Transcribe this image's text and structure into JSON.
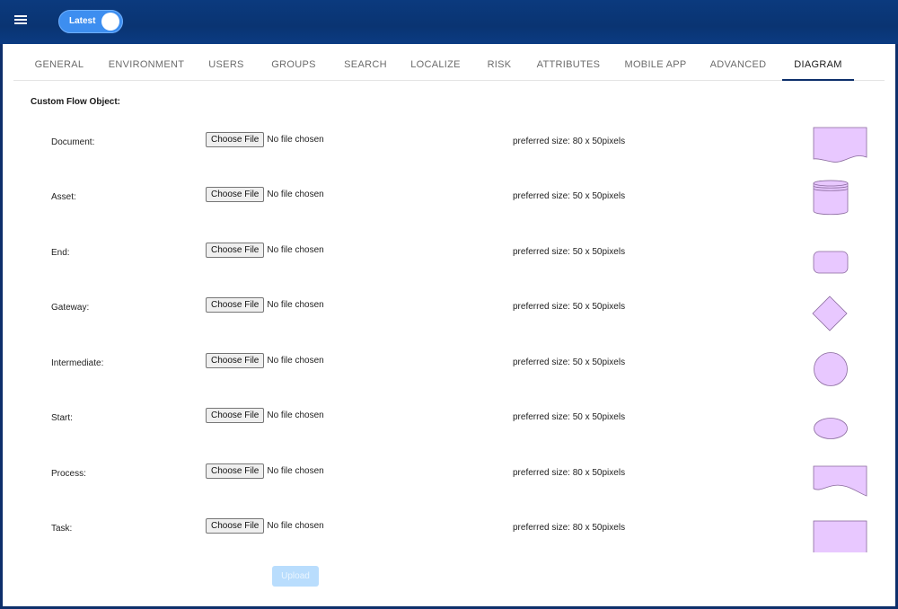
{
  "header": {
    "menu_icon": "hamburger-icon",
    "version_toggle_label": "Latest"
  },
  "tabs": [
    {
      "label": "GENERAL"
    },
    {
      "label": "ENVIRONMENT"
    },
    {
      "label": "USERS"
    },
    {
      "label": "GROUPS"
    },
    {
      "label": "SEARCH"
    },
    {
      "label": "LOCALIZE"
    },
    {
      "label": "RISK"
    },
    {
      "label": "ATTRIBUTES"
    },
    {
      "label": "MOBILE APP"
    },
    {
      "label": "ADVANCED"
    },
    {
      "label": "DIAGRAM"
    }
  ],
  "active_tab": "DIAGRAM",
  "section_title": "Custom Flow Object:",
  "choose_file_label": "Choose File",
  "no_file_text": "No file chosen",
  "rows": [
    {
      "name": "Document:",
      "size": "preferred size: 80 x 50pixels",
      "shape": "document-shape-icon"
    },
    {
      "name": "Asset:",
      "size": "preferred size: 50 x 50pixels",
      "shape": "database-cylinder-icon"
    },
    {
      "name": "End:",
      "size": "preferred size: 50 x 50pixels",
      "shape": "rounded-rectangle-icon"
    },
    {
      "name": "Gateway:",
      "size": "preferred size: 50 x 50pixels",
      "shape": "diamond-icon"
    },
    {
      "name": "Intermediate:",
      "size": "preferred size: 50 x 50pixels",
      "shape": "circle-icon"
    },
    {
      "name": "Start:",
      "size": "preferred size: 50 x 50pixels",
      "shape": "ellipse-icon"
    },
    {
      "name": "Process:",
      "size": "preferred size: 80 x 50pixels",
      "shape": "wave-rectangle-icon"
    },
    {
      "name": "Task:",
      "size": "preferred size: 80 x 50pixels",
      "shape": "rectangle-icon"
    }
  ],
  "upload_label": "Upload",
  "colors": {
    "header_bg": "#0b3a7e",
    "toggle_bg": "#3d8ef0",
    "shape_fill": "#e8c8ff",
    "shape_stroke": "#8a6a9e",
    "upload_disabled": "#b9ddfd"
  }
}
